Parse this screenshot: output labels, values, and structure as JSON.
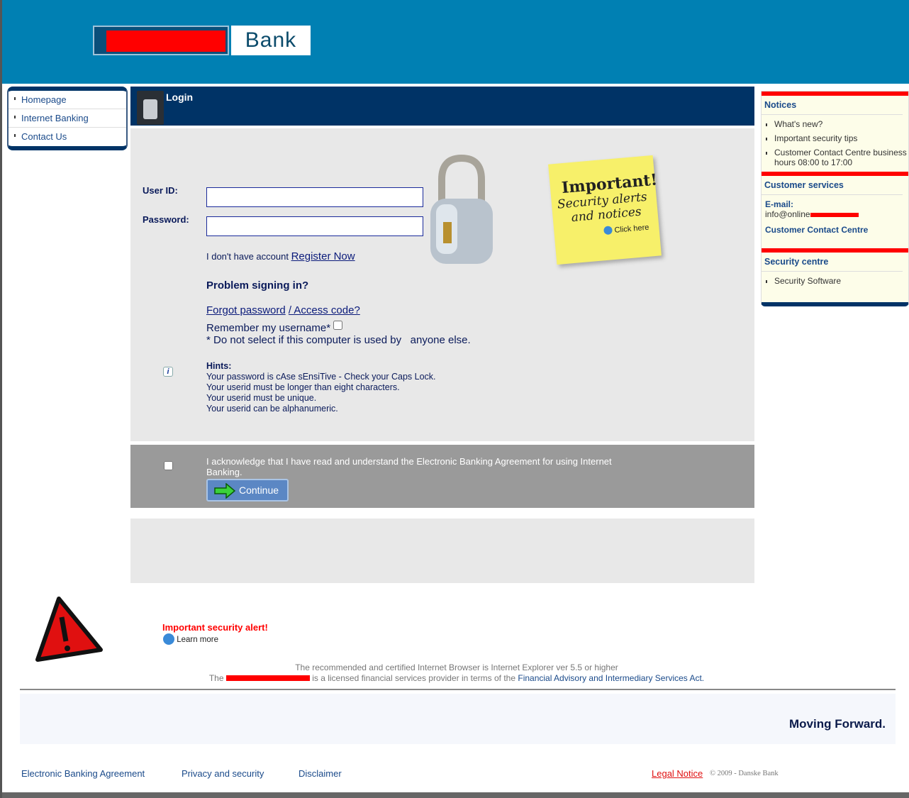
{
  "header": {
    "logo_text": "Bank"
  },
  "nav": {
    "items": [
      {
        "label": "Homepage"
      },
      {
        "label": "Internet Banking"
      },
      {
        "label": "Contact Us"
      }
    ]
  },
  "login": {
    "title": "Login",
    "user_id_label": "User ID:",
    "password_label": "Password:",
    "user_id_value": "",
    "password_value": "",
    "no_account": "I don't have account",
    "register": "Register Now",
    "problem": "Problem signing in?",
    "forgot": "Forgot password",
    "access_code": "/ Access code?",
    "remember": "Remember my username*",
    "remember_checked": false,
    "note": "* Do not select if this computer is used by   anyone else.",
    "hints_title": "Hints:",
    "hints": [
      "Your password is cAse sEnsiTive - Check your Caps Lock.",
      "Your userid must be longer than eight characters.",
      "Your userid must be unique.",
      "Your userid can be alphanumeric."
    ]
  },
  "sticky": {
    "line1": "Important!",
    "line2": "Security alerts",
    "line3": "and notices",
    "click": "Click here"
  },
  "ack": {
    "text": "I acknowledge that I have read and understand the Electronic Banking Agreement for using Internet Banking.",
    "checked": false,
    "continue": "Continue"
  },
  "right": {
    "notices_title": "Notices",
    "notices": [
      "What's new?",
      "Important security tips",
      "Customer Contact Centre business hours 08:00 to 17:00"
    ],
    "cs_title": "Customer services",
    "email_label": "E-mail:",
    "email_prefix": "info@online",
    "contact_centre": "Customer Contact Centre",
    "sec_title": "Security centre",
    "sec_items": [
      "Security Software"
    ]
  },
  "alert": {
    "title": "Important security alert!",
    "learn": "Learn more"
  },
  "footer": {
    "browser": "The recommended and certified Internet Browser is Internet Explorer ver 5.5 or higher",
    "provider_prefix": "The",
    "provider_mid": "is a licensed financial services provider in terms of the",
    "act": "Financial Advisory and Intermediary Services Act.",
    "slogan": "Moving Forward.",
    "links": [
      "Electronic Banking Agreement",
      "Privacy and security",
      "Disclaimer"
    ],
    "legal": "Legal Notice",
    "copyright": "© 2009 - Danske Bank"
  },
  "colors": {
    "header": "#0080b3",
    "navy": "#003366",
    "accent_red": "#ff0000"
  }
}
